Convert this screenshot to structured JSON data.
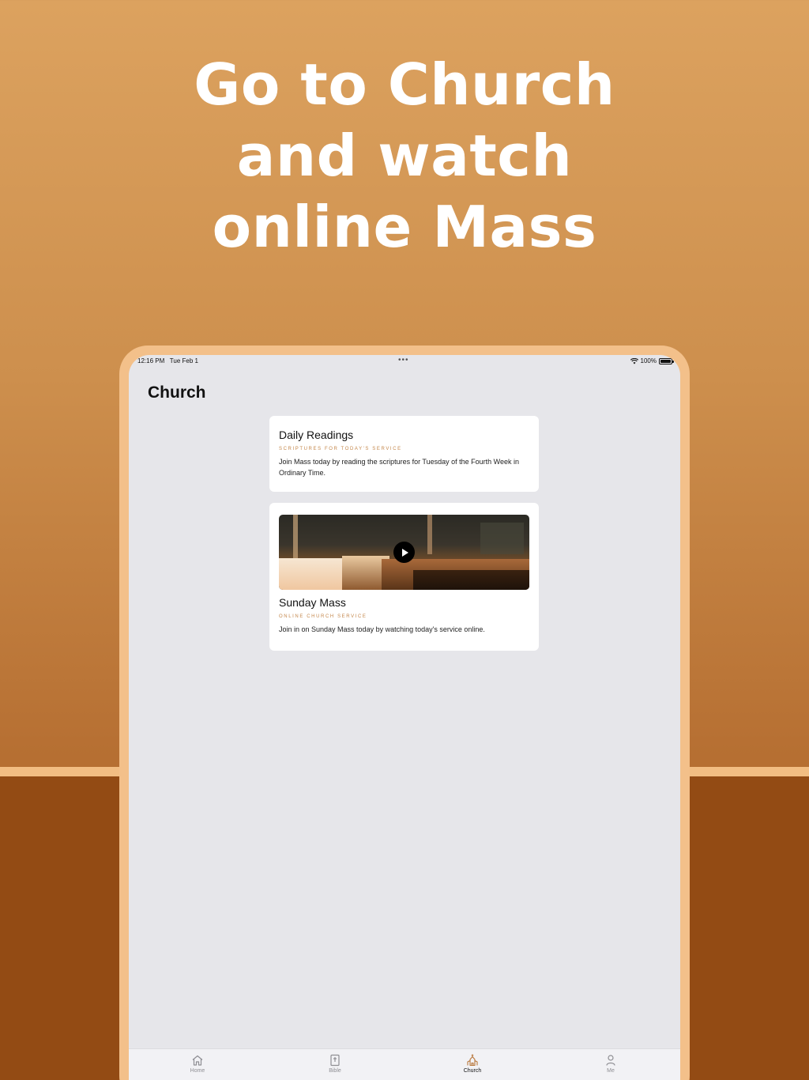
{
  "headline": {
    "line1": "Go to Church",
    "line2": "and watch",
    "line3": "online Mass"
  },
  "status_bar": {
    "time": "12:16 PM",
    "date": "Tue Feb 1",
    "battery": "100%",
    "battery_level": 1.0
  },
  "page": {
    "title": "Church"
  },
  "cards": {
    "readings": {
      "title": "Daily Readings",
      "subtitle": "SCRIPTURES FOR TODAY'S SERVICE",
      "description": "Join Mass today by reading the scriptures for Tuesday of the Fourth Week in Ordinary Time."
    },
    "mass": {
      "title": "Sunday Mass",
      "subtitle": "ONLINE CHURCH SERVICE",
      "description": "Join in on Sunday Mass today by watching today's service online."
    }
  },
  "tabs": {
    "home": "Home",
    "bible": "Bible",
    "church": "Church",
    "me": "Me",
    "active": "church"
  },
  "colors": {
    "accent": "#c4874b",
    "device_frame": "#f3c08a",
    "band": "#934b14"
  },
  "icons": {
    "home": "house-icon",
    "bible": "book-cross-icon",
    "church": "church-icon",
    "me": "person-icon",
    "play": "play-icon"
  }
}
